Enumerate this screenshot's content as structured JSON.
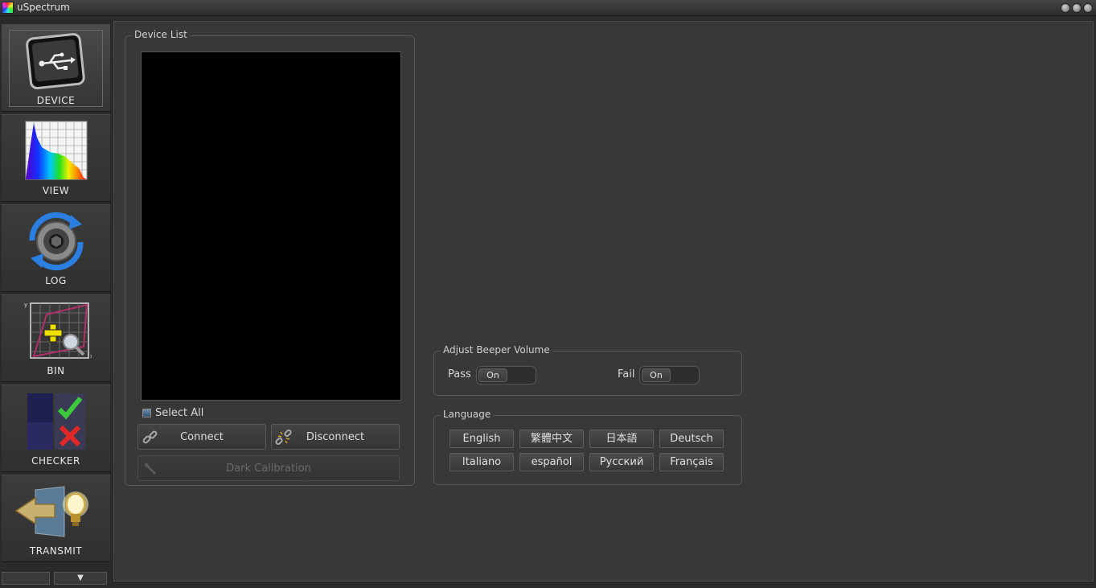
{
  "window": {
    "title": "uSpectrum"
  },
  "sidebar": {
    "items": [
      {
        "label": "DEVICE",
        "icon": "usb-icon"
      },
      {
        "label": "VIEW",
        "icon": "spectrum-chart-icon"
      },
      {
        "label": "LOG",
        "icon": "refresh-camera-icon"
      },
      {
        "label": "BIN",
        "icon": "bin-graph-magnifier-icon"
      },
      {
        "label": "CHECKER",
        "icon": "check-cross-icon"
      },
      {
        "label": "TRANSMIT",
        "icon": "transmit-bulb-icon"
      }
    ],
    "scroll_down": "▼"
  },
  "device_list": {
    "title": "Device List",
    "select_all": "Select All",
    "connect": "Connect",
    "disconnect": "Disconnect",
    "dark_calibration": "Dark Calibration"
  },
  "beeper": {
    "title": "Adjust Beeper Volume",
    "pass_label": "Pass",
    "pass_state": "On",
    "fail_label": "Fail",
    "fail_state": "On"
  },
  "language": {
    "title": "Language",
    "options": [
      "English",
      "繁體中文",
      "日本語",
      "Deutsch",
      "Italiano",
      "español",
      "Русский",
      "Français"
    ]
  }
}
